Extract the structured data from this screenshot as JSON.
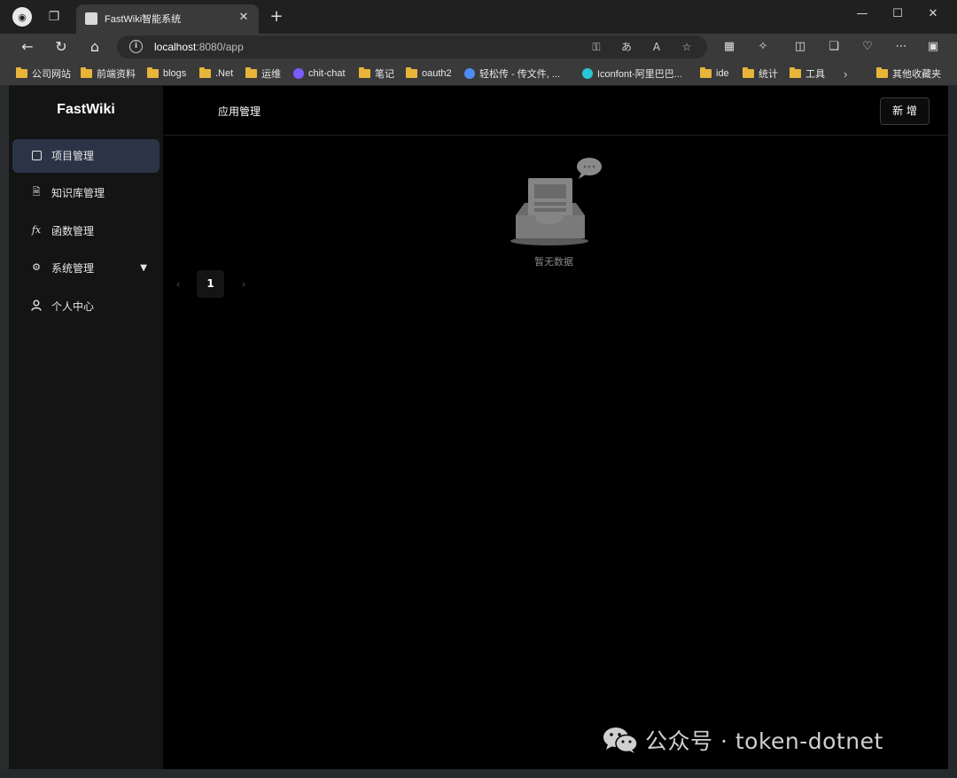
{
  "browser": {
    "tab_title": "FastWiki智能系统",
    "url_host": "localhost",
    "url_rest": ":8080/app",
    "bookmarks": [
      {
        "label": "公司网站",
        "icon": "folder-icon"
      },
      {
        "label": "前端资料",
        "icon": "folder-icon"
      },
      {
        "label": "blogs",
        "icon": "folder-icon"
      },
      {
        "label": ".Net",
        "icon": "folder-icon"
      },
      {
        "label": "运维",
        "icon": "folder-icon"
      },
      {
        "label": "chit-chat",
        "icon": "site-icon"
      },
      {
        "label": "笔记",
        "icon": "folder-icon"
      },
      {
        "label": "oauth2",
        "icon": "folder-icon"
      },
      {
        "label": "轻松传 - 传文件, ...",
        "icon": "site-icon"
      },
      {
        "label": "Iconfont-阿里巴巴...",
        "icon": "site-icon"
      },
      {
        "label": "ide",
        "icon": "folder-icon"
      },
      {
        "label": "统计",
        "icon": "folder-icon"
      },
      {
        "label": "工具",
        "icon": "folder-icon"
      },
      {
        "label": "其他收藏夹",
        "icon": "folder-icon"
      }
    ]
  },
  "app": {
    "logo": "FastWiki",
    "menu": [
      {
        "label": "项目管理",
        "icon": "project-icon",
        "active": true
      },
      {
        "label": "知识库管理",
        "icon": "document-icon",
        "active": false
      },
      {
        "label": "函数管理",
        "icon": "function-icon",
        "active": false
      },
      {
        "label": "系统管理",
        "icon": "gear-icon",
        "active": false,
        "expandable": true
      },
      {
        "label": "个人中心",
        "icon": "user-icon",
        "active": false
      }
    ],
    "header_title": "应用管理",
    "add_label": "新 增",
    "empty_text": "暂无数据",
    "pagination": {
      "current": "1"
    }
  },
  "watermark": {
    "text": "公众号 · token-dotnet"
  }
}
